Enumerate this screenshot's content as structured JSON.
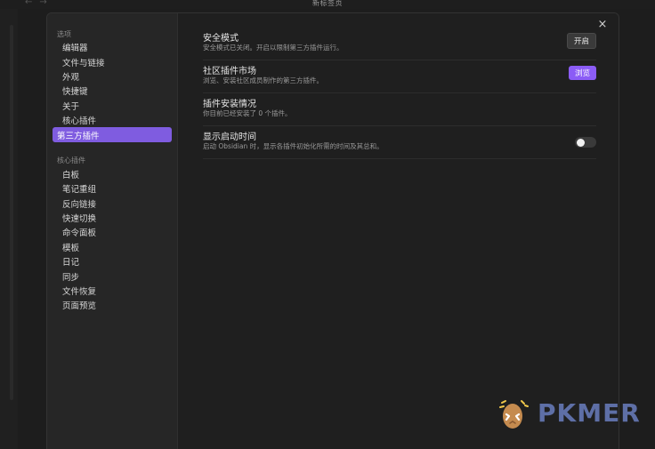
{
  "window": {
    "title": "新标签页",
    "nav_back": "←",
    "nav_forward": "→"
  },
  "sidebar": {
    "groups": [
      {
        "title": "选项",
        "items": [
          {
            "label": "编辑器",
            "active": false
          },
          {
            "label": "文件与链接",
            "active": false
          },
          {
            "label": "外观",
            "active": false
          },
          {
            "label": "快捷键",
            "active": false
          },
          {
            "label": "关于",
            "active": false
          },
          {
            "label": "核心插件",
            "active": false
          },
          {
            "label": "第三方插件",
            "active": true
          }
        ]
      },
      {
        "title": "核心插件",
        "items": [
          {
            "label": "白板"
          },
          {
            "label": "笔记重组"
          },
          {
            "label": "反向链接"
          },
          {
            "label": "快速切换"
          },
          {
            "label": "命令面板"
          },
          {
            "label": "模板"
          },
          {
            "label": "日记"
          },
          {
            "label": "同步"
          },
          {
            "label": "文件恢复"
          },
          {
            "label": "页面预览"
          }
        ]
      }
    ]
  },
  "content": {
    "rows": [
      {
        "title": "安全模式",
        "desc": "安全模式已关闭。开启以限制第三方插件运行。",
        "control": "button",
        "button_label": "开启"
      },
      {
        "title": "社区插件市场",
        "desc": "浏览、安装社区成员制作的第三方插件。",
        "control": "button-accent",
        "button_label": "浏览"
      },
      {
        "title": "插件安装情况",
        "desc": "你目前已经安装了 0 个插件。"
      },
      {
        "title": "显示启动时间",
        "desc": "启动 Obsidian 时，显示各插件初始化所需的时间及其总和。",
        "control": "toggle",
        "toggle_on": false
      }
    ]
  },
  "close_icon": "×",
  "watermark": {
    "text": "PKMER",
    "icon": "egg-mascot-icon"
  },
  "colors": {
    "accent": "#8b5cf6",
    "sidebar_active": "#7f5ce0",
    "watermark": "#5e6fa6"
  }
}
